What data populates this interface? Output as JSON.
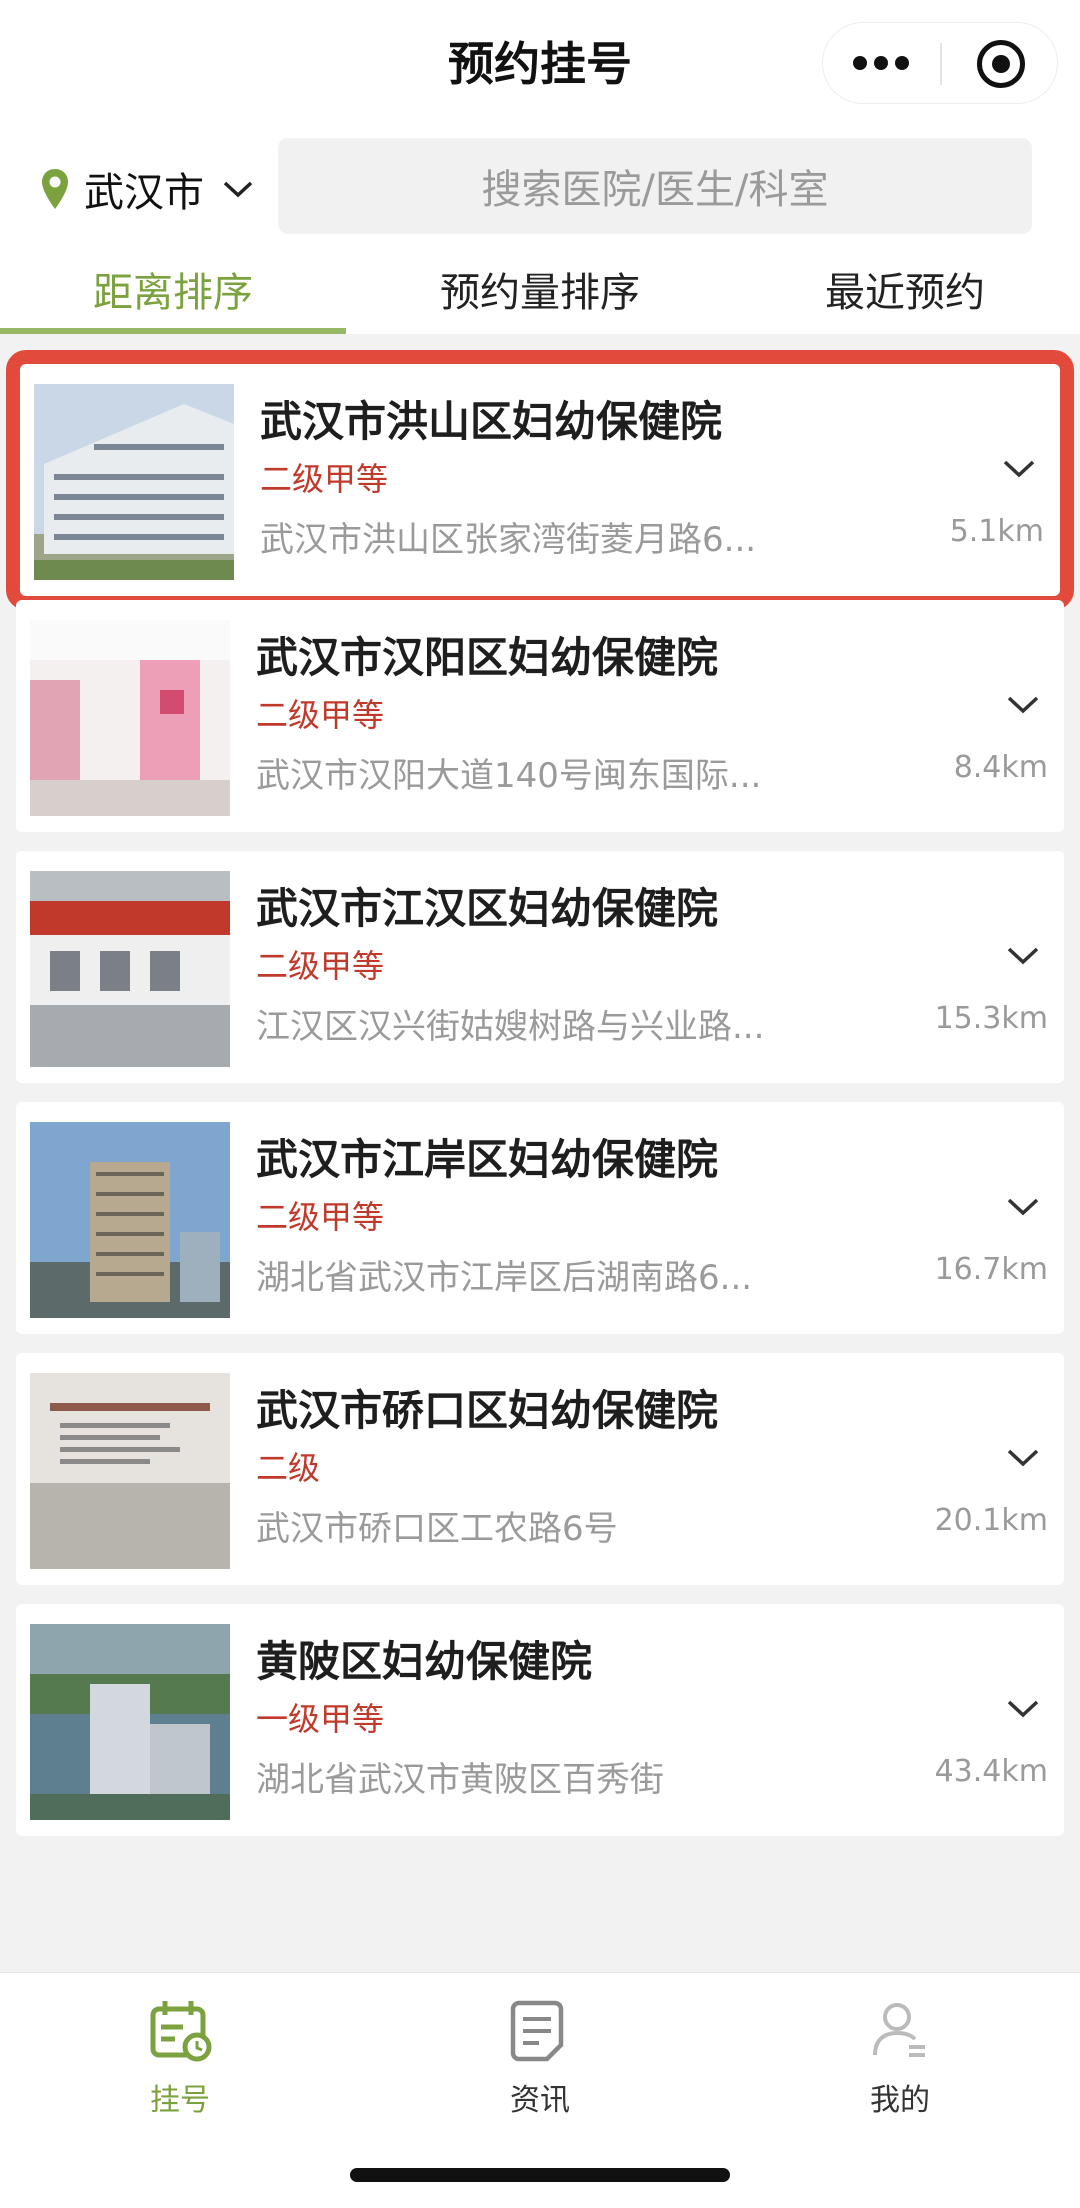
{
  "header": {
    "title": "预约挂号",
    "more_icon": "more-icon",
    "target_icon": "target-icon"
  },
  "location": {
    "city": "武汉市",
    "pin_icon": "location-pin-icon",
    "chevron_icon": "chevron-down-icon",
    "pin_color": "#7ba23f"
  },
  "search": {
    "placeholder": "搜索医院/医生/科室"
  },
  "tabs": [
    {
      "label": "距离排序",
      "active": true
    },
    {
      "label": "预约量排序",
      "active": false
    },
    {
      "label": "最近预约",
      "active": false
    }
  ],
  "hospitals": [
    {
      "name": "武汉市洪山区妇幼保健院",
      "grade": "二级甲等",
      "address": "武汉市洪山区张家湾街菱月路6...",
      "distance": "5.1km",
      "highlighted": true
    },
    {
      "name": "武汉市汉阳区妇幼保健院",
      "grade": "二级甲等",
      "address": "武汉市汉阳大道140号闽东国际...",
      "distance": "8.4km",
      "highlighted": false
    },
    {
      "name": "武汉市江汉区妇幼保健院",
      "grade": "二级甲等",
      "address": "江汉区汉兴街姑嫂树路与兴业路...",
      "distance": "15.3km",
      "highlighted": false
    },
    {
      "name": "武汉市江岸区妇幼保健院",
      "grade": "二级甲等",
      "address": "湖北省武汉市江岸区后湖南路6...",
      "distance": "16.7km",
      "highlighted": false
    },
    {
      "name": "武汉市硚口区妇幼保健院",
      "grade": "二级",
      "address": "武汉市硚口区工农路6号",
      "distance": "20.1km",
      "highlighted": false
    },
    {
      "name": "黄陂区妇幼保健院",
      "grade": "一级甲等",
      "address": "湖北省武汉市黄陂区百秀街",
      "distance": "43.4km",
      "highlighted": false
    }
  ],
  "bottom_nav": [
    {
      "label": "挂号",
      "icon": "calendar-icon",
      "active": true
    },
    {
      "label": "资讯",
      "icon": "document-icon",
      "active": false
    },
    {
      "label": "我的",
      "icon": "user-icon",
      "active": false
    }
  ],
  "colors": {
    "accent": "#7ba23f",
    "grade_red": "#c0392b",
    "highlight_border": "#e24a3c"
  }
}
